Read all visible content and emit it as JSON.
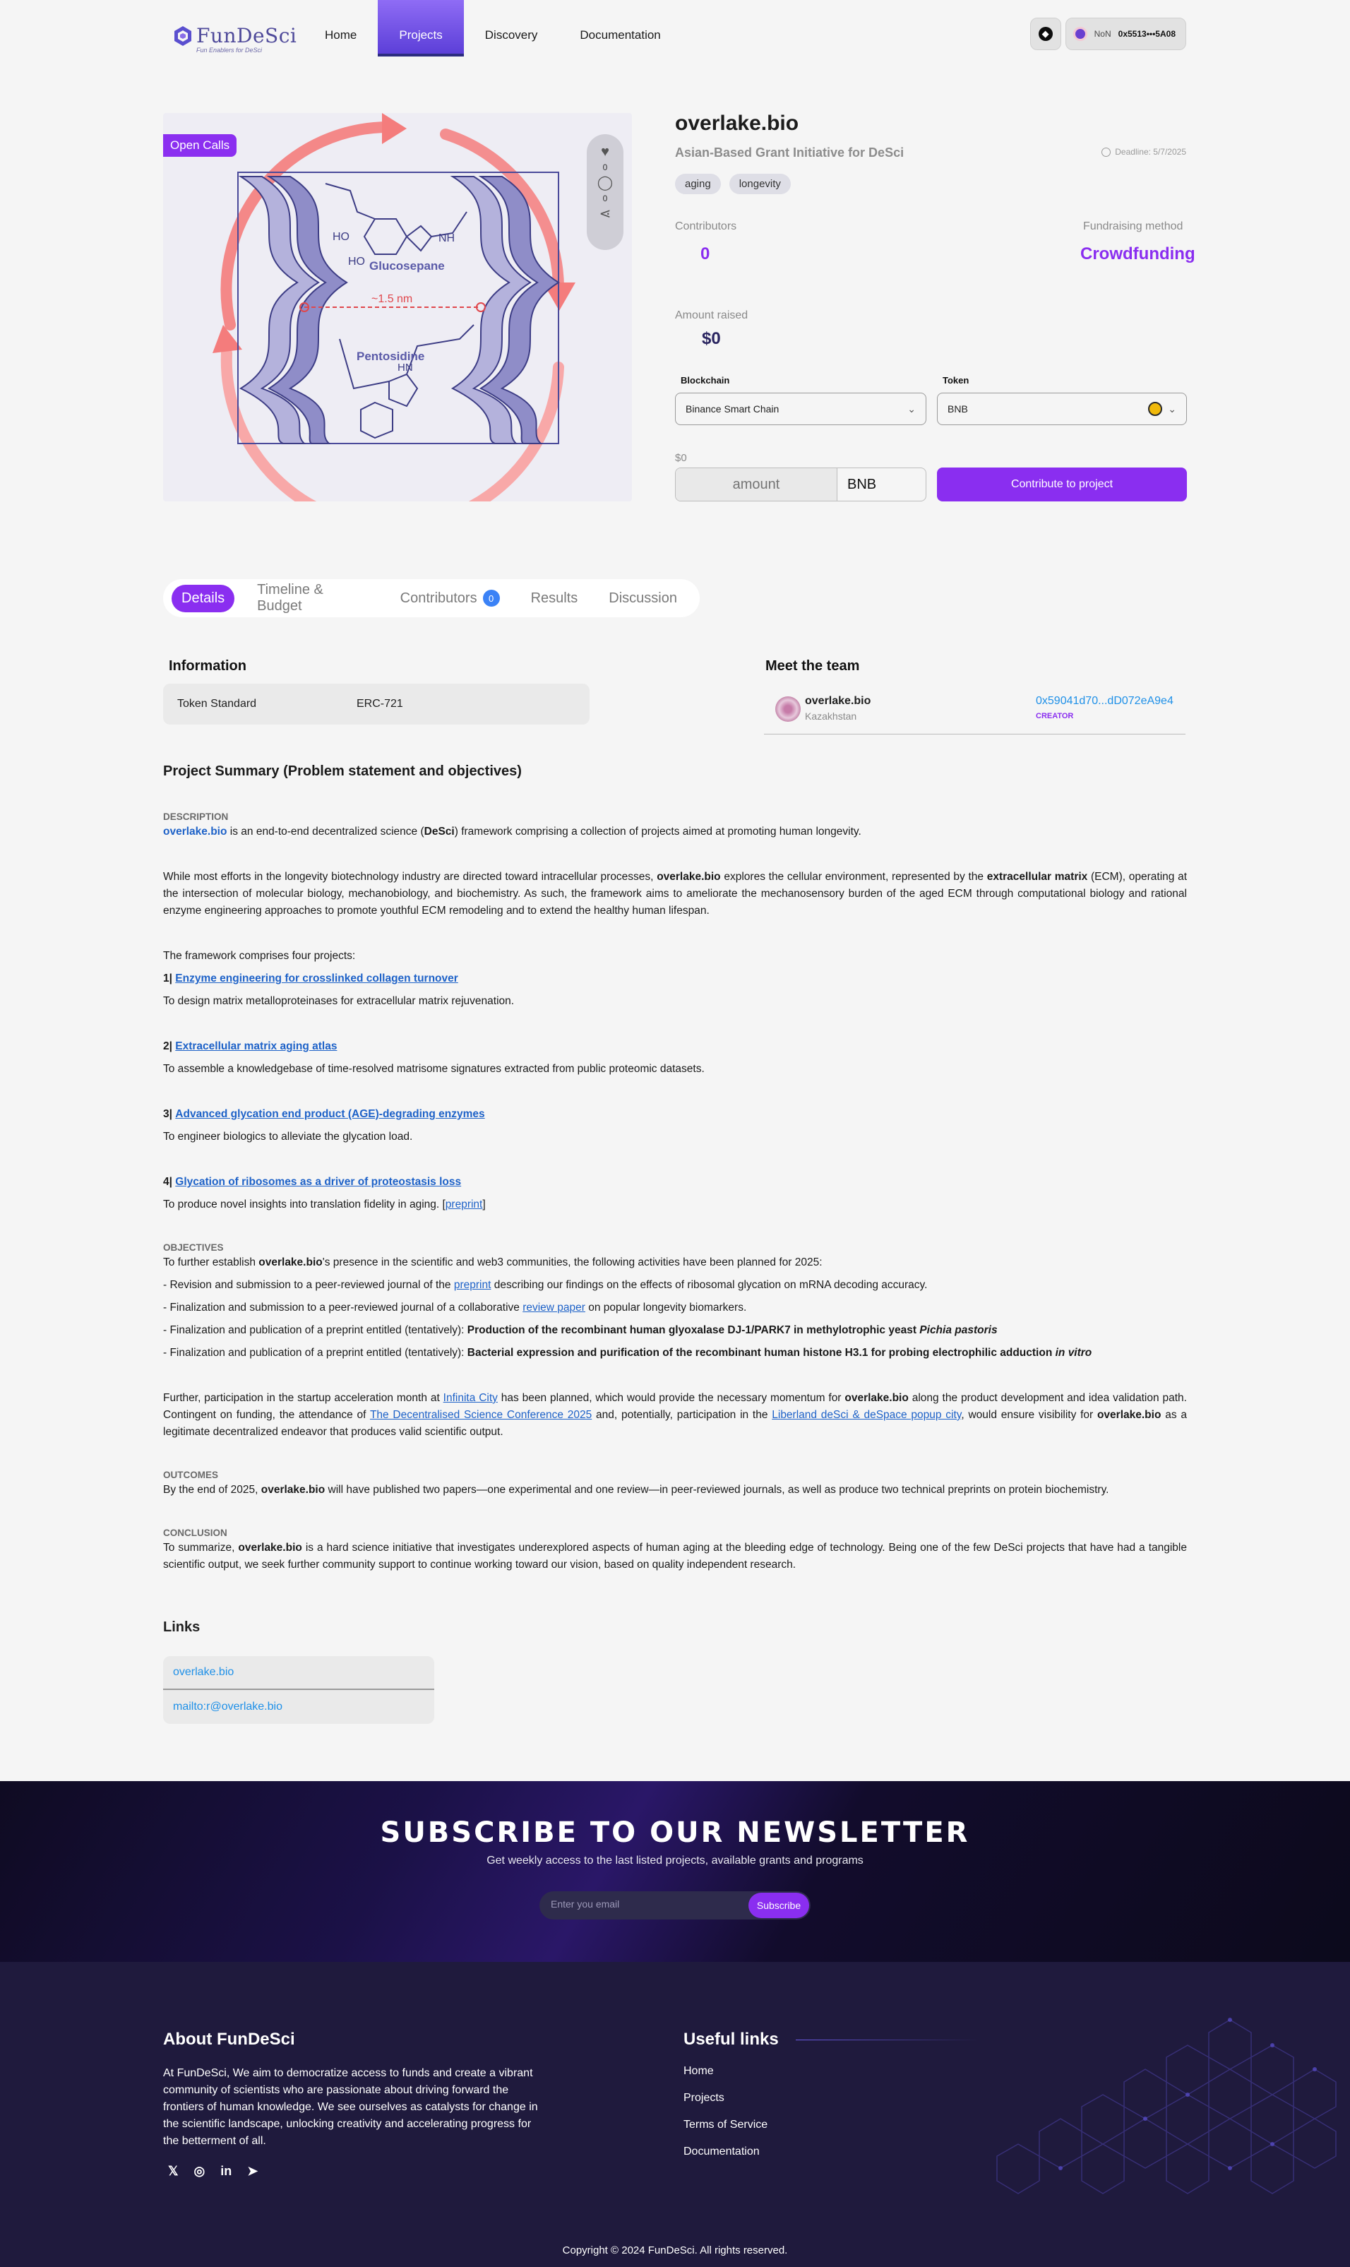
{
  "header": {
    "logo": {
      "name": "FunDeSci",
      "tagline": "Fun Enablers for DeSci"
    },
    "nav": [
      "Home",
      "Projects",
      "Discovery",
      "Documentation"
    ],
    "active_nav": "Projects",
    "wallet": {
      "network": "NoN",
      "address": "0x5513•••5A08"
    }
  },
  "project": {
    "badge": "Open Calls",
    "likes": "0",
    "comments": "0",
    "title": "overlake.bio",
    "subtitle": "Asian-Based Grant Initiative for DeSci",
    "deadline": "Deadline: 5/7/2025",
    "tags": [
      "aging",
      "longevity"
    ],
    "contributors_label": "Contributors",
    "contributors_value": "0",
    "fundraising_label": "Fundraising method",
    "fundraising_value": "Crowdfunding",
    "amount_raised_label": "Amount raised",
    "amount_raised_value": "$0",
    "blockchain_label": "Blockchain",
    "blockchain_value": "Binance Smart Chain",
    "token_label": "Token",
    "token_value": "BNB",
    "balance": "$0",
    "amount_placeholder": "amount",
    "amount_currency": "BNB",
    "contribute_button": "Contribute to project",
    "image_labels": {
      "top_molecule": "Glucosepane",
      "distance": "~1.5 nm",
      "bottom_molecule": "Pentosidine"
    }
  },
  "tabs": [
    {
      "label": "Details"
    },
    {
      "label": "Timeline & Budget"
    },
    {
      "label": "Contributors",
      "count": "0"
    },
    {
      "label": "Results"
    },
    {
      "label": "Discussion"
    }
  ],
  "information": {
    "heading": "Information",
    "key": "Token Standard",
    "value": "ERC-721"
  },
  "team": {
    "heading": "Meet the team",
    "name": "overlake.bio",
    "location": "Kazakhstan",
    "address": "0x59041d70...dD072eA9e4",
    "role": "CREATOR"
  },
  "summary": {
    "heading": "Project Summary (Problem statement and objectives)",
    "description_caption": "DESCRIPTION",
    "objectives_caption": "OBJECTIVES",
    "outcomes_caption": "OUTCOMES",
    "conclusion_caption": "CONCLUSION"
  },
  "links": {
    "heading": "Links",
    "items": [
      "overlake.bio",
      "mailto:r@overlake.bio"
    ]
  },
  "newsletter": {
    "title": "SUBSCRIBE TO OUR NEWSLETTER",
    "subtitle": "Get weekly access to the last listed projects, available grants and programs",
    "placeholder": "Enter you email",
    "button": "Subscribe"
  },
  "footer": {
    "about_heading": "About FunDeSci",
    "about_text": "At FunDeSci, We aim to democratize access to funds and create a vibrant community of scientists who are passionate about driving forward the frontiers of human knowledge. We see ourselves as catalysts for change in the scientific landscape, unlocking creativity and accelerating progress for the betterment of all.",
    "useful_heading": "Useful links",
    "useful_links": [
      "Home",
      "Projects",
      "Terms of Service",
      "Documentation"
    ],
    "copyright": "Copyright © 2024 FunDeSci. All rights reserved."
  }
}
